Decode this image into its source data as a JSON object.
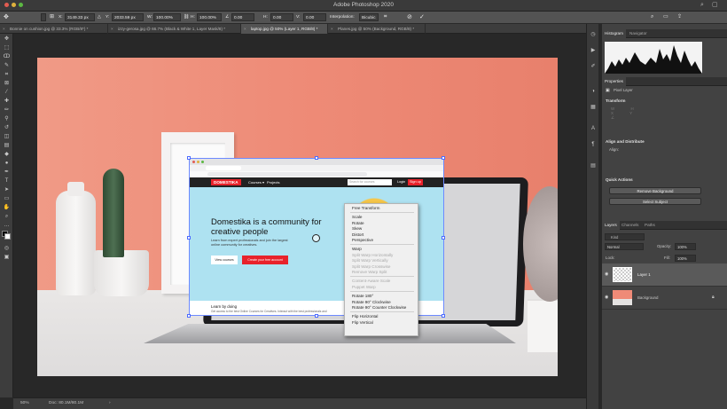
{
  "app": {
    "title": "Adobe Photoshop 2020"
  },
  "options_bar": {
    "x_label": "X:",
    "x_value": "3149.33 px",
    "y_label": "Y:",
    "y_value": "2033.59 px",
    "w_label": "W:",
    "w_value": "100.00%",
    "h_label": "H:",
    "h_value": "100.00%",
    "angle_value": "0.00",
    "hskew_label": "H:",
    "hskew_value": "0.00",
    "vskew_label": "V:",
    "vskew_value": "0.00",
    "interpolation_label": "Interpolation:",
    "interpolation_value": "Bicubic"
  },
  "tabs": [
    {
      "label": "Bonnie on cushion.jpg @ 33.3% (RGB/8*) *"
    },
    {
      "label": "izzy-gerosa.jpg @ 66.7% (Black & White 1, Layer Mask/8) *"
    },
    {
      "label": "laptop.jpg @ 50% (Layer 1, RGB/8) *"
    },
    {
      "label": "Planes.jpg @ 50% (Background, RGB/8) *"
    }
  ],
  "status": {
    "zoom": "50%",
    "doc": "Doc: 80.1M/80.1M"
  },
  "website": {
    "brand": "DOMESTIKA",
    "nav_courses": "Courses ▾",
    "nav_projects": "Projects",
    "search_placeholder": "Search for courses",
    "login": "Login",
    "signup": "Sign up",
    "headline": "Domestika is a community for creative people",
    "subtext": "Learn from expert professionals and join the largest online community for creatives.",
    "btn_view": "View courses",
    "btn_create": "Create your free account",
    "learn_title": "Learn by doing",
    "learn_sub": "Get access to the best Online Courses for Creatives. Interact with the best professionals and"
  },
  "context_menu": {
    "items": [
      {
        "label": "Free Transform",
        "disabled": false,
        "sep_after": true
      },
      {
        "label": "Scale",
        "disabled": false
      },
      {
        "label": "Rotate",
        "disabled": false
      },
      {
        "label": "Skew",
        "disabled": false
      },
      {
        "label": "Distort",
        "disabled": false
      },
      {
        "label": "Perspective",
        "disabled": false,
        "sep_after": true
      },
      {
        "label": "Warp",
        "disabled": false
      },
      {
        "label": "Split Warp Horizontally",
        "disabled": true
      },
      {
        "label": "Split Warp Vertically",
        "disabled": true
      },
      {
        "label": "Split Warp Crosswise",
        "disabled": true
      },
      {
        "label": "Remove Warp Split",
        "disabled": true,
        "sep_after": true
      },
      {
        "label": "Content-Aware Scale",
        "disabled": true
      },
      {
        "label": "Puppet Warp",
        "disabled": true,
        "sep_after": true
      },
      {
        "label": "Rotate 180°",
        "disabled": false
      },
      {
        "label": "Rotate 90° Clockwise",
        "disabled": false
      },
      {
        "label": "Rotate 90° Counter Clockwise",
        "disabled": false,
        "sep_after": true
      },
      {
        "label": "Flip Horizontal",
        "disabled": false
      },
      {
        "label": "Flip Vertical",
        "disabled": false
      }
    ]
  },
  "panels": {
    "histogram_tab": "Histogram",
    "navigator_tab": "Navigator",
    "properties_tab": "Properties",
    "pixel_layer": "Pixel Layer",
    "transform_section": "Transform",
    "align_section": "Align and Distribute",
    "align_label": "Align:",
    "quick_actions": "Quick Actions",
    "remove_bg": "Remove Background",
    "select_subject": "Select Subject",
    "layers_tab": "Layers",
    "channels_tab": "Channels",
    "paths_tab": "Paths",
    "kind_label": "Kind",
    "blend_mode": "Normal",
    "opacity_label": "Opacity:",
    "opacity_value": "100%",
    "lock_label": "Lock:",
    "fill_label": "Fill:",
    "fill_value": "100%",
    "layers": [
      {
        "name": "Layer 1"
      },
      {
        "name": "Background"
      }
    ]
  },
  "colors": {
    "accent": "#1473e6",
    "wall": "#ef8a77",
    "domestika_red": "#e8222b",
    "site_bg": "#aee2f1"
  }
}
